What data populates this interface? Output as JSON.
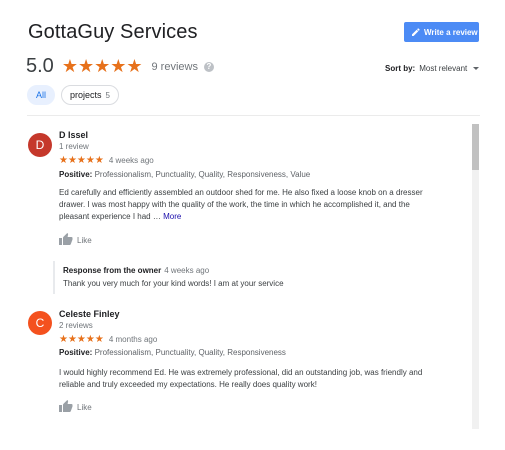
{
  "header": {
    "title": "GottaGuy Services",
    "write_review_label": "Write a review"
  },
  "summary": {
    "score": "5.0",
    "stars": "★★★★★",
    "review_count": "9 reviews",
    "help_icon": "?"
  },
  "sort": {
    "label": "Sort by:",
    "value": "Most relevant"
  },
  "chips": [
    {
      "label": "All"
    },
    {
      "label": "projects",
      "count": "5"
    }
  ],
  "reviews": [
    {
      "initial": "D",
      "avatar_color": "#c5382b",
      "name": "D Issel",
      "sub": "1 review",
      "stars": "★★★★★",
      "when": "4 weeks ago",
      "positive_label": "Positive:",
      "positive_list": "Professionalism, Punctuality, Quality, Responsiveness, Value",
      "lines": [
        "Ed carefully and efficiently assembled an outdoor shed for me.  He also fixed a loose knob on a dresser",
        "drawer.  I was most happy with the quality of the work, the time in which he accomplished it, and the",
        "pleasant experience I had … "
      ],
      "more": "More",
      "like": "Like",
      "owner_response": {
        "title": "Response from the owner",
        "when": "4 weeks ago",
        "text": "Thank you very much for your kind words! I am at your service"
      }
    },
    {
      "initial": "C",
      "avatar_color": "#f4511e",
      "name": "Celeste Finley",
      "sub": "2 reviews",
      "stars": "★★★★★",
      "when": "4 months ago",
      "positive_label": "Positive:",
      "positive_list": "Professionalism, Punctuality, Quality, Responsiveness",
      "lines": [
        "I would highly recommend Ed. He was extremely professional, did an outstanding job, was friendly and",
        "reliable and truly exceeded my expectations. He really does quality work!"
      ],
      "like": "Like"
    }
  ]
}
